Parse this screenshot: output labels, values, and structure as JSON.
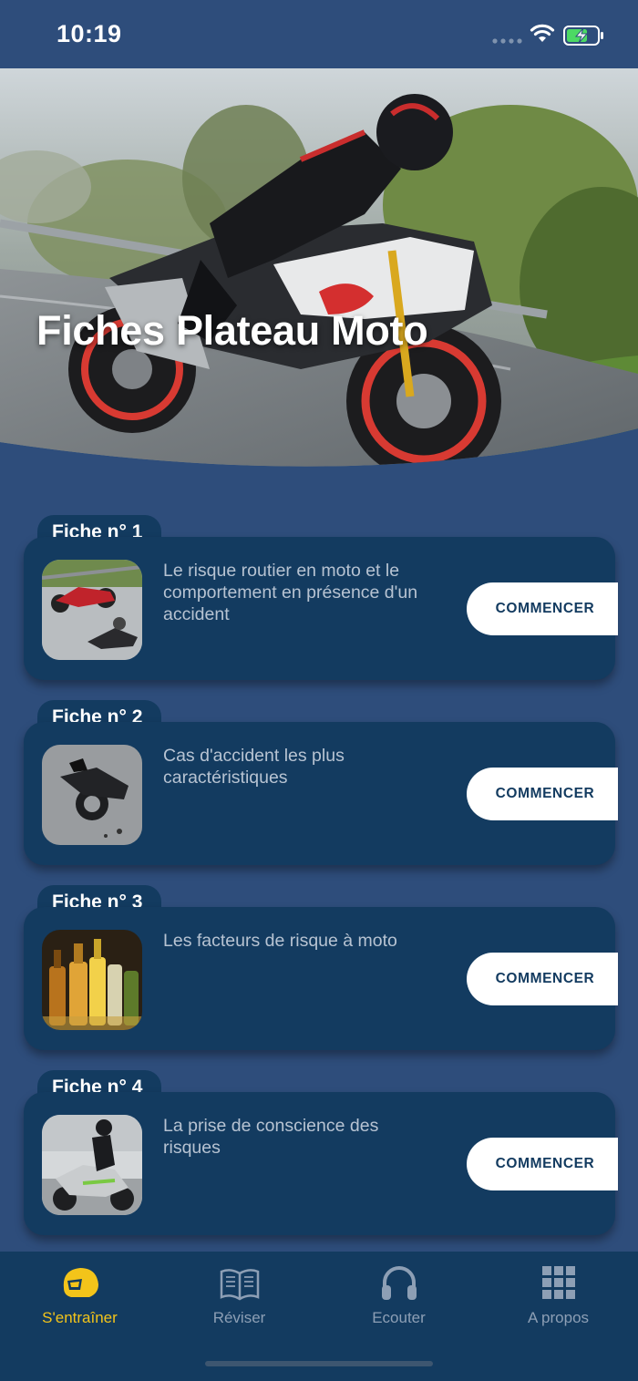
{
  "status_bar": {
    "time": "10:19"
  },
  "hero": {
    "title": "Fiches Plateau Moto"
  },
  "cards": [
    {
      "tab": "Fiche n° 1",
      "description": "Le risque routier en moto et le comportement en présence d'un accident",
      "button": "COMMENCER",
      "thumb_icon": "motorcycle-crash-photo"
    },
    {
      "tab": "Fiche n° 2",
      "description": "Cas d'accident les plus caractéristiques",
      "button": "COMMENCER",
      "thumb_icon": "fallen-motorcycle-photo"
    },
    {
      "tab": "Fiche n° 3",
      "description": "Les facteurs de risque à moto",
      "button": "COMMENCER",
      "thumb_icon": "alcohol-bottles-photo"
    },
    {
      "tab": "Fiche n° 4",
      "description": "La prise de conscience des risques",
      "button": "COMMENCER",
      "thumb_icon": "scooter-rider-photo"
    }
  ],
  "tab_bar": {
    "items": [
      {
        "label": "S'entraîner",
        "icon": "helmet-icon",
        "active": true
      },
      {
        "label": "Réviser",
        "icon": "book-icon",
        "active": false
      },
      {
        "label": "Ecouter",
        "icon": "headphones-icon",
        "active": false
      },
      {
        "label": "A propos",
        "icon": "grid-icon",
        "active": false
      }
    ]
  },
  "colors": {
    "background": "#2e4d7b",
    "card": "#133b60",
    "accent": "#f3c41a",
    "inactive": "#8d9fb5",
    "battery": "#4cd964"
  }
}
